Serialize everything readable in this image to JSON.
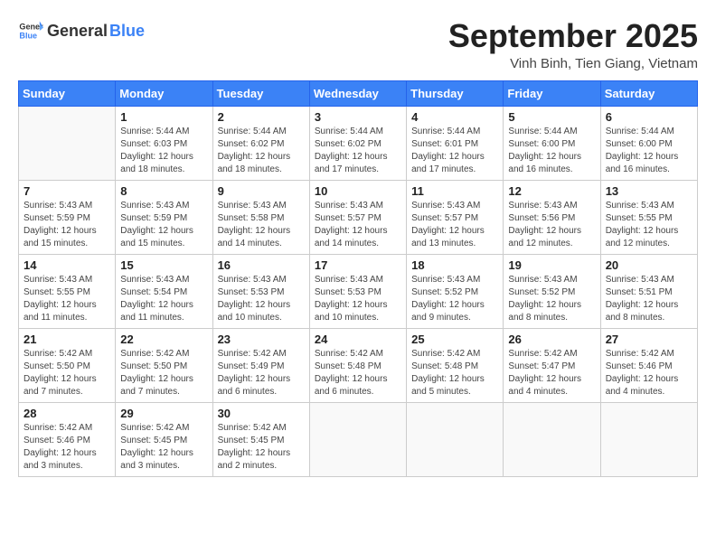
{
  "header": {
    "logo_general": "General",
    "logo_blue": "Blue",
    "title": "September 2025",
    "subtitle": "Vinh Binh, Tien Giang, Vietnam"
  },
  "weekdays": [
    "Sunday",
    "Monday",
    "Tuesday",
    "Wednesday",
    "Thursday",
    "Friday",
    "Saturday"
  ],
  "weeks": [
    [
      {
        "day": "",
        "info": ""
      },
      {
        "day": "1",
        "info": "Sunrise: 5:44 AM\nSunset: 6:03 PM\nDaylight: 12 hours\nand 18 minutes."
      },
      {
        "day": "2",
        "info": "Sunrise: 5:44 AM\nSunset: 6:02 PM\nDaylight: 12 hours\nand 18 minutes."
      },
      {
        "day": "3",
        "info": "Sunrise: 5:44 AM\nSunset: 6:02 PM\nDaylight: 12 hours\nand 17 minutes."
      },
      {
        "day": "4",
        "info": "Sunrise: 5:44 AM\nSunset: 6:01 PM\nDaylight: 12 hours\nand 17 minutes."
      },
      {
        "day": "5",
        "info": "Sunrise: 5:44 AM\nSunset: 6:00 PM\nDaylight: 12 hours\nand 16 minutes."
      },
      {
        "day": "6",
        "info": "Sunrise: 5:44 AM\nSunset: 6:00 PM\nDaylight: 12 hours\nand 16 minutes."
      }
    ],
    [
      {
        "day": "7",
        "info": "Sunrise: 5:43 AM\nSunset: 5:59 PM\nDaylight: 12 hours\nand 15 minutes."
      },
      {
        "day": "8",
        "info": "Sunrise: 5:43 AM\nSunset: 5:59 PM\nDaylight: 12 hours\nand 15 minutes."
      },
      {
        "day": "9",
        "info": "Sunrise: 5:43 AM\nSunset: 5:58 PM\nDaylight: 12 hours\nand 14 minutes."
      },
      {
        "day": "10",
        "info": "Sunrise: 5:43 AM\nSunset: 5:57 PM\nDaylight: 12 hours\nand 14 minutes."
      },
      {
        "day": "11",
        "info": "Sunrise: 5:43 AM\nSunset: 5:57 PM\nDaylight: 12 hours\nand 13 minutes."
      },
      {
        "day": "12",
        "info": "Sunrise: 5:43 AM\nSunset: 5:56 PM\nDaylight: 12 hours\nand 12 minutes."
      },
      {
        "day": "13",
        "info": "Sunrise: 5:43 AM\nSunset: 5:55 PM\nDaylight: 12 hours\nand 12 minutes."
      }
    ],
    [
      {
        "day": "14",
        "info": "Sunrise: 5:43 AM\nSunset: 5:55 PM\nDaylight: 12 hours\nand 11 minutes."
      },
      {
        "day": "15",
        "info": "Sunrise: 5:43 AM\nSunset: 5:54 PM\nDaylight: 12 hours\nand 11 minutes."
      },
      {
        "day": "16",
        "info": "Sunrise: 5:43 AM\nSunset: 5:53 PM\nDaylight: 12 hours\nand 10 minutes."
      },
      {
        "day": "17",
        "info": "Sunrise: 5:43 AM\nSunset: 5:53 PM\nDaylight: 12 hours\nand 10 minutes."
      },
      {
        "day": "18",
        "info": "Sunrise: 5:43 AM\nSunset: 5:52 PM\nDaylight: 12 hours\nand 9 minutes."
      },
      {
        "day": "19",
        "info": "Sunrise: 5:43 AM\nSunset: 5:52 PM\nDaylight: 12 hours\nand 8 minutes."
      },
      {
        "day": "20",
        "info": "Sunrise: 5:43 AM\nSunset: 5:51 PM\nDaylight: 12 hours\nand 8 minutes."
      }
    ],
    [
      {
        "day": "21",
        "info": "Sunrise: 5:42 AM\nSunset: 5:50 PM\nDaylight: 12 hours\nand 7 minutes."
      },
      {
        "day": "22",
        "info": "Sunrise: 5:42 AM\nSunset: 5:50 PM\nDaylight: 12 hours\nand 7 minutes."
      },
      {
        "day": "23",
        "info": "Sunrise: 5:42 AM\nSunset: 5:49 PM\nDaylight: 12 hours\nand 6 minutes."
      },
      {
        "day": "24",
        "info": "Sunrise: 5:42 AM\nSunset: 5:48 PM\nDaylight: 12 hours\nand 6 minutes."
      },
      {
        "day": "25",
        "info": "Sunrise: 5:42 AM\nSunset: 5:48 PM\nDaylight: 12 hours\nand 5 minutes."
      },
      {
        "day": "26",
        "info": "Sunrise: 5:42 AM\nSunset: 5:47 PM\nDaylight: 12 hours\nand 4 minutes."
      },
      {
        "day": "27",
        "info": "Sunrise: 5:42 AM\nSunset: 5:46 PM\nDaylight: 12 hours\nand 4 minutes."
      }
    ],
    [
      {
        "day": "28",
        "info": "Sunrise: 5:42 AM\nSunset: 5:46 PM\nDaylight: 12 hours\nand 3 minutes."
      },
      {
        "day": "29",
        "info": "Sunrise: 5:42 AM\nSunset: 5:45 PM\nDaylight: 12 hours\nand 3 minutes."
      },
      {
        "day": "30",
        "info": "Sunrise: 5:42 AM\nSunset: 5:45 PM\nDaylight: 12 hours\nand 2 minutes."
      },
      {
        "day": "",
        "info": ""
      },
      {
        "day": "",
        "info": ""
      },
      {
        "day": "",
        "info": ""
      },
      {
        "day": "",
        "info": ""
      }
    ]
  ]
}
